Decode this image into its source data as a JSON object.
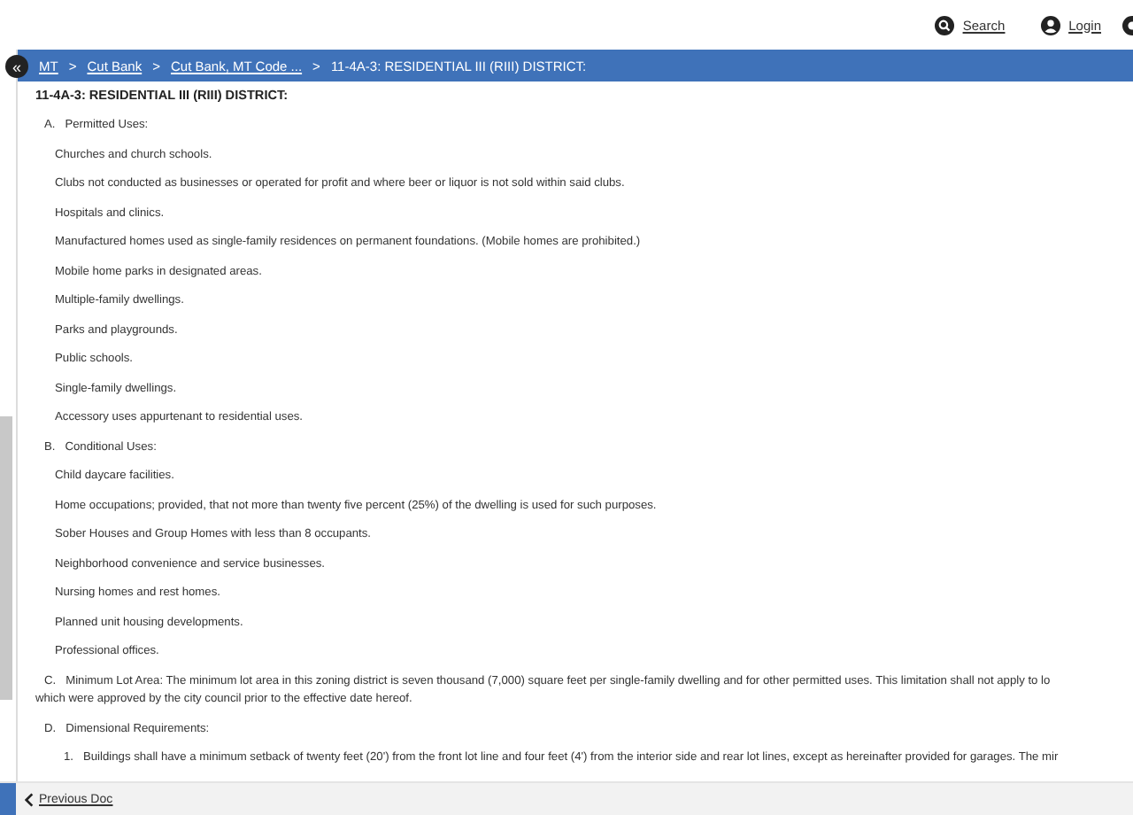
{
  "header": {
    "links": [
      {
        "kind": "search",
        "label": "Search"
      },
      {
        "kind": "login",
        "label": "Login"
      }
    ]
  },
  "breadcrumb": {
    "collapse_button": "«",
    "items": [
      {
        "label": "MT",
        "link": true
      },
      {
        "label": "Cut Bank",
        "link": true
      },
      {
        "label": "Cut Bank, MT Code ...",
        "link": true
      },
      {
        "label": "11-4A-3: RESIDENTIAL III (RIII) DISTRICT:",
        "link": false
      }
    ],
    "separator": ">"
  },
  "document": {
    "title": "11-4A-3: RESIDENTIAL III (RIII) DISTRICT:",
    "blocks": [
      {
        "kind": "heading",
        "marker": "A.",
        "text": "Permitted Uses:"
      },
      {
        "kind": "item",
        "text": "Churches and church schools."
      },
      {
        "kind": "item",
        "text": "Clubs not conducted as businesses or operated for profit and where beer or liquor is not sold within said clubs."
      },
      {
        "kind": "item",
        "text": "Hospitals and clinics."
      },
      {
        "kind": "item",
        "text": "Manufactured homes used as single-family residences on permanent foundations. (Mobile homes are prohibited.)"
      },
      {
        "kind": "item",
        "text": "Mobile home parks in designated areas."
      },
      {
        "kind": "item",
        "text": "Multiple-family dwellings."
      },
      {
        "kind": "item",
        "text": "Parks and playgrounds."
      },
      {
        "kind": "item",
        "text": "Public schools."
      },
      {
        "kind": "item",
        "text": "Single-family dwellings."
      },
      {
        "kind": "item",
        "text": "Accessory uses appurtenant to residential uses."
      },
      {
        "kind": "heading",
        "marker": "B.",
        "text": "Conditional Uses:"
      },
      {
        "kind": "item",
        "text": "Child daycare facilities."
      },
      {
        "kind": "item",
        "text": "Home occupations; provided, that not more than twenty five percent (25%) of the dwelling is used for such purposes."
      },
      {
        "kind": "item",
        "text": "Sober Houses and Group Homes with less than 8 occupants."
      },
      {
        "kind": "item",
        "text": "Neighborhood convenience and service businesses."
      },
      {
        "kind": "item",
        "text": "Nursing homes and rest homes."
      },
      {
        "kind": "item",
        "text": "Planned unit housing developments."
      },
      {
        "kind": "item",
        "text": "Professional offices."
      },
      {
        "kind": "paragraph",
        "marker": "C.",
        "text": "Minimum Lot Area: The minimum lot area in this zoning district is seven thousand (7,000) square feet per single-family dwelling and for other permitted uses. This limitation shall not apply to lo",
        "continuation": "which were approved by the city council prior to the effective date hereof."
      },
      {
        "kind": "heading",
        "marker": "D.",
        "text": "Dimensional Requirements:"
      },
      {
        "kind": "numbered",
        "marker": "1.",
        "text": "Buildings shall have a minimum setback of twenty feet (20') from the front lot line and four feet (4') from the interior side and rear lot lines, except as hereinafter provided for garages. The mir"
      }
    ]
  },
  "footer": {
    "previous": "Previous Doc"
  }
}
